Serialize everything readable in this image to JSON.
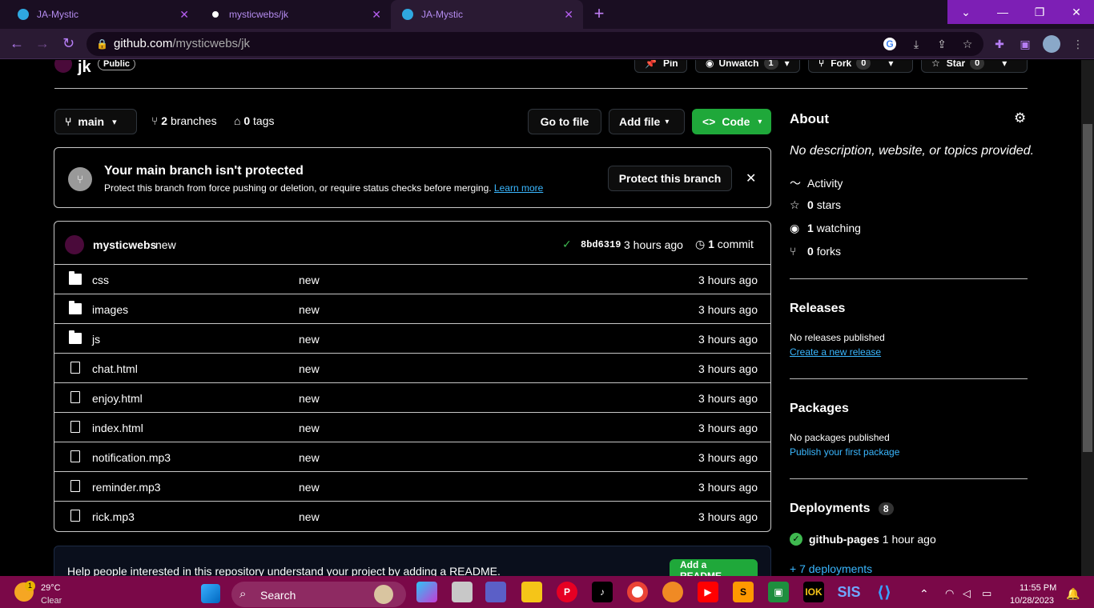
{
  "browser": {
    "tabs": [
      {
        "title": "JA-Mystic",
        "active": false
      },
      {
        "title": "mysticwebs/jk",
        "active": false
      },
      {
        "title": "JA-Mystic",
        "active": true
      }
    ],
    "url_host": "github.com",
    "url_path": "/mysticwebs/jk"
  },
  "repo": {
    "name": "jk",
    "visibility": "Public",
    "actions": {
      "pin": "Pin",
      "unwatch": "Unwatch",
      "unwatch_count": "1",
      "fork": "Fork",
      "fork_count": "0",
      "star": "Star",
      "star_count": "0"
    },
    "branch": "main",
    "branches": "2 branches",
    "branches_count": "2",
    "branches_label": "branches",
    "tags_count": "0",
    "tags_label": "tags",
    "go_to_file": "Go to file",
    "add_file": "Add file",
    "code": "Code"
  },
  "protect_banner": {
    "title": "Your main branch isn't protected",
    "text": "Protect this branch from force pushing or deletion, or require status checks before merging.",
    "link": "Learn more",
    "button": "Protect this branch"
  },
  "commit": {
    "author": "mysticwebs",
    "message": "new",
    "sha": "8bd6319",
    "time": "3 hours ago",
    "commits_count": "1",
    "commits_label": "commit"
  },
  "files": [
    {
      "name": "css",
      "type": "folder",
      "message": "new",
      "age": "3 hours ago"
    },
    {
      "name": "images",
      "type": "folder",
      "message": "new",
      "age": "3 hours ago"
    },
    {
      "name": "js",
      "type": "folder",
      "message": "new",
      "age": "3 hours ago"
    },
    {
      "name": "chat.html",
      "type": "file",
      "message": "new",
      "age": "3 hours ago"
    },
    {
      "name": "enjoy.html",
      "type": "file",
      "message": "new",
      "age": "3 hours ago"
    },
    {
      "name": "index.html",
      "type": "file",
      "message": "new",
      "age": "3 hours ago"
    },
    {
      "name": "notification.mp3",
      "type": "file",
      "message": "new",
      "age": "3 hours ago"
    },
    {
      "name": "reminder.mp3",
      "type": "file",
      "message": "new",
      "age": "3 hours ago"
    },
    {
      "name": "rick.mp3",
      "type": "file",
      "message": "new",
      "age": "3 hours ago"
    }
  ],
  "readme_banner": {
    "text": "Help people interested in this repository understand your project by adding a README.",
    "button": "Add a README"
  },
  "about": {
    "title": "About",
    "description": "No description, website, or topics provided.",
    "activity": "Activity",
    "stars_count": "0",
    "stars_label": "stars",
    "watching_count": "1",
    "watching_label": "watching",
    "forks_count": "0",
    "forks_label": "forks"
  },
  "releases": {
    "title": "Releases",
    "text": "No releases published",
    "link": "Create a new release"
  },
  "packages": {
    "title": "Packages",
    "text": "No packages published",
    "link": "Publish your first package"
  },
  "deployments": {
    "title": "Deployments",
    "count": "8",
    "env": "github-pages",
    "env_time": "1 hour ago",
    "more": "+ 7 deployments"
  },
  "taskbar": {
    "weather_temp": "29°C",
    "weather_desc": "Clear",
    "weather_badge": "1",
    "search": "Search",
    "time": "11:55 PM",
    "date": "10/28/2023",
    "apps": [
      "windows-start",
      "search",
      "copilot",
      "file-explorer",
      "teams",
      "folder",
      "pinterest",
      "tiktok",
      "chrome",
      "fl-studio",
      "youtube",
      "sublime",
      "classroom",
      "iok",
      "sis",
      "vscode"
    ]
  }
}
